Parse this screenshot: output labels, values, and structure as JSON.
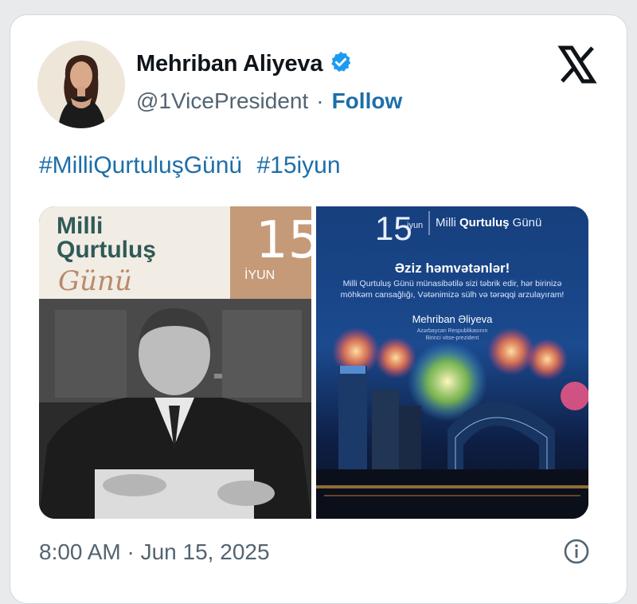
{
  "author": {
    "name": "Mehriban Aliyeva",
    "handle": "@1VicePresident",
    "separator": "·",
    "follow_label": "Follow",
    "verified_icon": "verified-badge-icon"
  },
  "brand_icon": "x-logo-icon",
  "hashtags": [
    "#MilliQurtuluşGünü",
    "#15iyun"
  ],
  "media": {
    "left": {
      "title_line1": "Milli",
      "title_line2": "Qurtuluş",
      "script_word": "Günü",
      "day_number": "15",
      "month": "İYUN"
    },
    "right": {
      "day_number": "15",
      "month": "iyun",
      "title_plain": "Milli",
      "title_bold": "Qurtuluş",
      "title_end": "Günü",
      "greeting": "Əziz həmvətənlər!",
      "message": "Milli Qurtuluş Günü münasibətilə sizi təbrik edir, hər birinizə möhkəm cansağlığı, Vətənimizə sülh və tərəqqi arzulayıram!",
      "signature": "Mehriban Əliyeva",
      "signature_title_line1": "Azərbaycan Respublikasının",
      "signature_title_line2": "Birinci vitse-prezident"
    }
  },
  "timestamp": "8:00 AM · Jun 15, 2025",
  "colors": {
    "link": "#1d6ea8",
    "verified": "#1d9bf0",
    "text": "#0f1419",
    "muted": "#536471"
  }
}
